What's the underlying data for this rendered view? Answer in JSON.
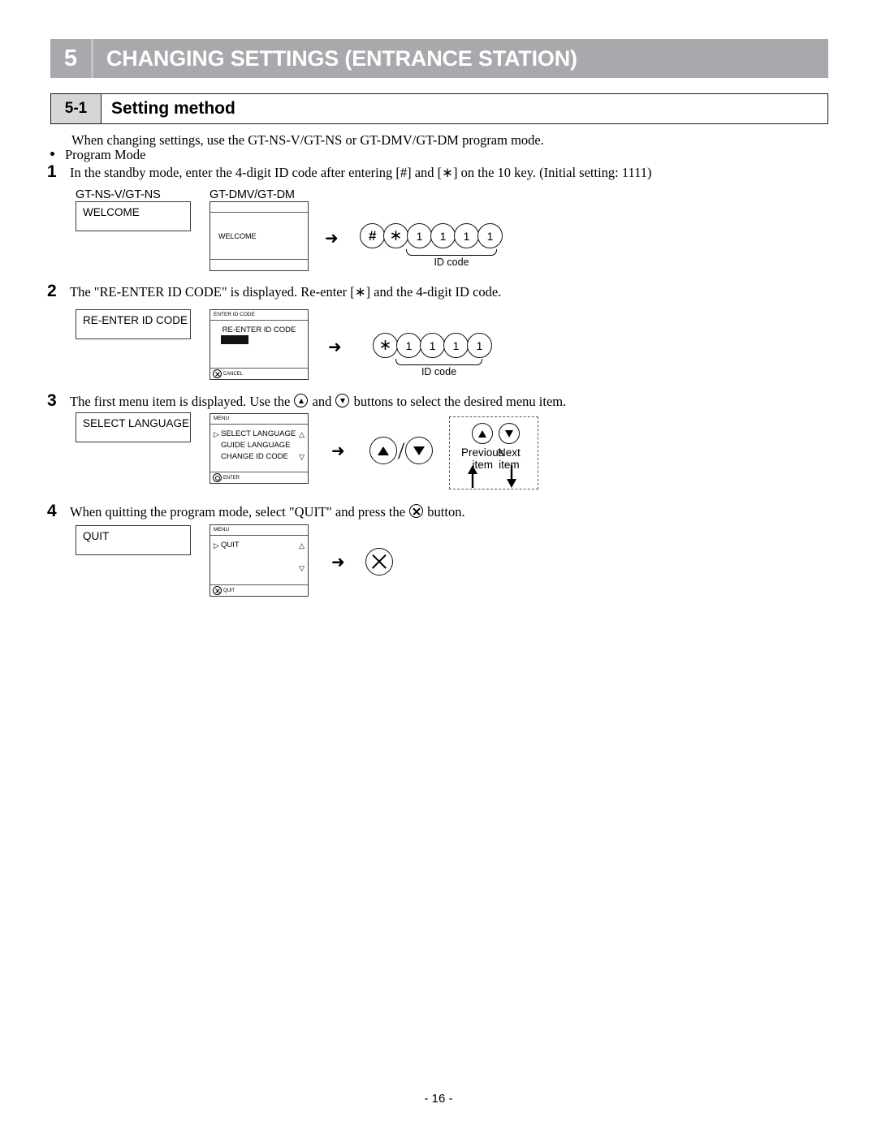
{
  "chapter": {
    "number": "5",
    "title": "CHANGING SETTINGS (ENTRANCE STATION)"
  },
  "section": {
    "number": "5-1",
    "title": "Setting method"
  },
  "intro": {
    "line": "When changing settings, use the GT-NS-V/GT-NS or GT-DMV/GT-DM program mode.",
    "bullet": "Program Mode"
  },
  "device_labels": {
    "left": "GT-NS-V/GT-NS",
    "right": "GT-DMV/GT-DM"
  },
  "steps": [
    {
      "number": "1",
      "text_a": "In the standby mode, enter the 4-digit ID code after entering [#] and [",
      "star": "∗",
      "text_b": "] on the 10 key. (Initial setting: 1111)",
      "simple_lcd": "WELCOME",
      "panel": {
        "header": "",
        "center": "WELCOME",
        "footer_label": "",
        "footer_icon": ""
      },
      "arrow": "➜",
      "keys": [
        "#",
        "∗",
        "1",
        "1",
        "1",
        "1"
      ],
      "brace_label": "ID code"
    },
    {
      "number": "2",
      "text_a": "The \"RE-ENTER ID CODE\" is displayed. Re-enter [",
      "star": "∗",
      "text_b": "] and the 4-digit ID code.",
      "simple_lcd": "RE-ENTER ID CODE",
      "panel": {
        "header": "ENTER ID CODE",
        "title": "RE-ENTER ID CODE",
        "footer_label": "CANCEL",
        "footer_icon": "circled-x-icon"
      },
      "arrow": "➜",
      "keys": [
        "∗",
        "1",
        "1",
        "1",
        "1"
      ],
      "brace_label": "ID code"
    },
    {
      "number": "3",
      "text_a": "The first menu item is displayed. Use the ",
      "text_b": " and ",
      "text_c": " buttons to select the desired menu item.",
      "simple_lcd": "SELECT LANGUAGE",
      "panel": {
        "header": "MENU",
        "menu_items": [
          {
            "caret": "▷",
            "label": "SELECT LANGUAGE",
            "arrow": "△"
          },
          {
            "caret": "",
            "label": "GUIDE LANGUAGE",
            "arrow": ""
          },
          {
            "caret": "",
            "label": "CHANGE ID CODE",
            "arrow": "▽"
          }
        ],
        "footer_label": "ENTER",
        "footer_icon": "circled-dot-icon"
      },
      "arrow": "➜",
      "buttons": [
        "up-triangle-button",
        "down-triangle-button"
      ],
      "separator": "/",
      "legend": {
        "previous": "Previous\nitem",
        "previous_l1": "Previous",
        "previous_l2": "item",
        "next_l1": "Next",
        "next_l2": "item"
      }
    },
    {
      "number": "4",
      "text_a": "When quitting the program mode, select \"QUIT\" and press the ",
      "text_b": " button.",
      "simple_lcd": "QUIT",
      "panel": {
        "header": "MENU",
        "menu_items": [
          {
            "caret": "▷",
            "label": "QUIT",
            "arrow": "△"
          },
          {
            "caret": "",
            "label": "",
            "arrow": "▽"
          }
        ],
        "footer_label": "QUIT",
        "footer_icon": "circled-x-icon"
      },
      "arrow": "➜",
      "button": "circled-x-button"
    }
  ],
  "footer": {
    "page_number": "- 16 -"
  },
  "colors": {
    "chapter_bar": "#a9a9ad",
    "section_tab": "#d6d6d6",
    "text": "#000000",
    "lcd_border": "#3a3a3a"
  }
}
